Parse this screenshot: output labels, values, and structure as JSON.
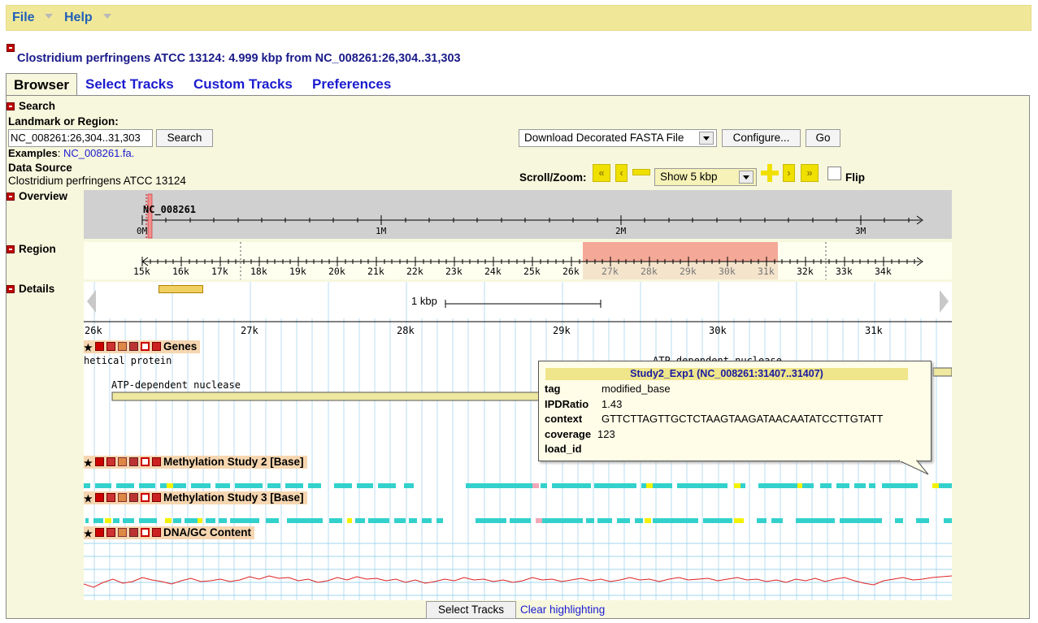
{
  "menu": {
    "file": "File",
    "help": "Help"
  },
  "page_title": "Clostridium perfringens ATCC 13124: 4.999 kbp from NC_008261:26,304..31,303",
  "tabs": [
    "Browser",
    "Select Tracks",
    "Custom Tracks",
    "Preferences"
  ],
  "search": {
    "section": "Search",
    "landmark_label": "Landmark or Region:",
    "landmark_value": "NC_008261:26,304..31,303",
    "search_button": "Search",
    "examples_label": "Examples",
    "examples_link": "NC_008261.fa.",
    "data_source_label": "Data Source",
    "data_source_value": "Clostridium perfringens ATCC 13124"
  },
  "download": {
    "selected": "Download Decorated FASTA File",
    "configure": "Configure...",
    "go": "Go"
  },
  "scroll_zoom": {
    "label": "Scroll/Zoom:",
    "zoom_selected": "Show 5 kbp",
    "flip_label": "Flip",
    "flip_checked": false
  },
  "overview": {
    "section": "Overview",
    "chrom": "NC_008261",
    "ticks": [
      "0M",
      "1M",
      "2M",
      "3M"
    ]
  },
  "region": {
    "section": "Region",
    "ticks": [
      "15k",
      "16k",
      "17k",
      "18k",
      "19k",
      "20k",
      "21k",
      "22k",
      "23k",
      "24k",
      "25k",
      "26k",
      "27k",
      "28k",
      "29k",
      "30k",
      "31k",
      "32k",
      "33k",
      "34k"
    ]
  },
  "details": {
    "section": "Details",
    "scale_label": "1 kbp",
    "ticks": [
      "26k",
      "27k",
      "28k",
      "29k",
      "30k",
      "31k"
    ]
  },
  "tracks": {
    "genes": {
      "label": "Genes",
      "feature1": "hetical protein",
      "feature2": "ATP-dependent nuclease",
      "feature3": "ATP-dependent nuclease"
    },
    "meth2": {
      "label": "Methylation Study 2 [Base]"
    },
    "meth3": {
      "label": "Methylation Study 3 [Base]"
    },
    "gc": {
      "label": "DNA/GC Content"
    }
  },
  "popup": {
    "title": "Study2_Exp1 (NC_008261:31407..31407)",
    "rows": [
      {
        "key": "tag",
        "value": "modified_base"
      },
      {
        "key": "IPDRatio",
        "value": "1.43"
      },
      {
        "key": "context",
        "value": "GTTCTTAGTTGCTCTAAGTAAGATAACAATATCCTTGTATT"
      },
      {
        "key": "coverage",
        "value": "123"
      },
      {
        "key": "load_id",
        "value": ""
      }
    ]
  },
  "footer": {
    "select_tracks": "Select Tracks",
    "clear_highlighting": "Clear highlighting"
  },
  "colors": {
    "menu_bg": "#f0e898",
    "panel_bg": "#f7f7dd",
    "link": "#1b1bd0",
    "highlight": "#f4a898",
    "meth_base": "#33d1cc",
    "meth_yellow": "#f2f200",
    "meth_pink": "#f0a8b8",
    "gc_line": "#dd2222"
  }
}
